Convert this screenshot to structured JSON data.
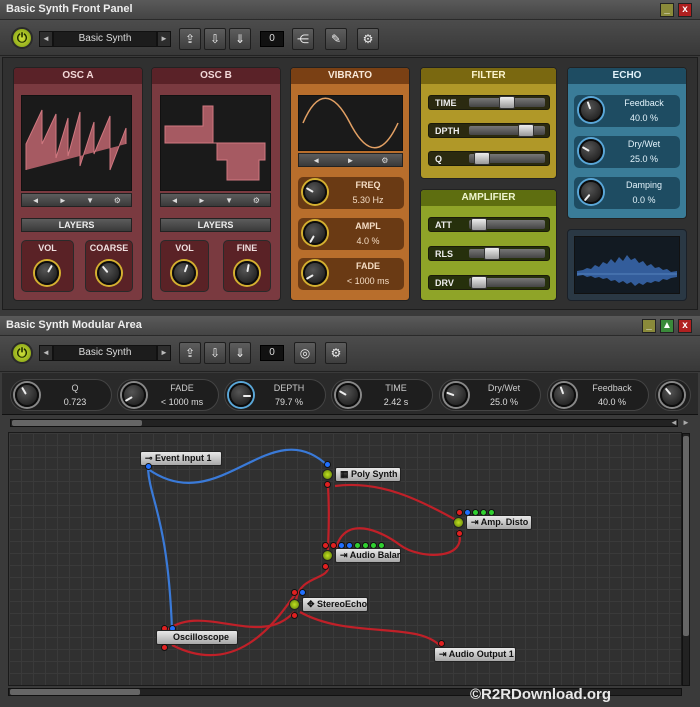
{
  "front_panel": {
    "title": "Basic Synth Front Panel",
    "window_buttons": [
      "_",
      "x"
    ],
    "preset_name": "Basic Synth",
    "counter": "0",
    "toolbar_icons": [
      "folder-up-icon",
      "folder-down-icon",
      "folder-save-icon",
      "wiring-icon",
      "pencil-icon",
      "gear-icon"
    ]
  },
  "osc_a": {
    "title": "OSC A",
    "nav": [
      "◄",
      "►",
      "▼",
      "⚙"
    ],
    "layers": "LAYERS",
    "knob1": "VOL",
    "knob2": "COARSE"
  },
  "osc_b": {
    "title": "OSC B",
    "nav": [
      "◄",
      "►",
      "▼",
      "⚙"
    ],
    "layers": "LAYERS",
    "knob1": "VOL",
    "knob2": "FINE"
  },
  "vibrato": {
    "title": "VIBRATO",
    "nav": [
      "◄",
      "►",
      "⚙"
    ],
    "params": [
      {
        "label": "FREQ",
        "value": "5.30 Hz"
      },
      {
        "label": "AMPL",
        "value": "4.0 %"
      },
      {
        "label": "FADE",
        "value": "< 1000 ms"
      }
    ]
  },
  "filter": {
    "title": "FILTER",
    "sliders": [
      {
        "label": "TIME",
        "level": 0.5
      },
      {
        "label": "DPTH",
        "level": 0.75
      },
      {
        "label": "Q",
        "level": 0.12
      }
    ]
  },
  "amplifier": {
    "title": "AMPLIFIER",
    "sliders": [
      {
        "label": "ATT",
        "level": 0.05
      },
      {
        "label": "RLS",
        "level": 0.2
      },
      {
        "label": "DRV",
        "level": 0.05
      }
    ]
  },
  "echo": {
    "title": "ECHO",
    "params": [
      {
        "label": "Feedback",
        "value": "40.0 %"
      },
      {
        "label": "Dry/Wet",
        "value": "25.0 %"
      },
      {
        "label": "Damping",
        "value": "0.0 %"
      }
    ]
  },
  "modular": {
    "title": "Basic Synth Modular Area",
    "window_buttons": [
      "_",
      "▲",
      "x"
    ],
    "preset_name": "Basic Synth",
    "counter": "0",
    "controls": [
      {
        "label": "Q",
        "value": "0.723"
      },
      {
        "label": "FADE",
        "value": "< 1000 ms"
      },
      {
        "label": "DEPTH",
        "value": "79.7 %"
      },
      {
        "label": "TIME",
        "value": "2.42 s"
      },
      {
        "label": "Dry/Wet",
        "value": "25.0 %"
      },
      {
        "label": "Feedback",
        "value": "40.0 %"
      }
    ],
    "nodes": {
      "event_input": "Event Input 1",
      "poly_synth": "Poly Synth",
      "amp_disto": "Amp. Disto",
      "audio_balance": "Audio Balar",
      "stereo_echo": "StereoEcho",
      "oscilloscope": "Oscilloscope",
      "audio_output": "Audio Output 1"
    }
  },
  "watermark": "©R2RDownload.org",
  "colors": {
    "osc": "#8a3c44",
    "vibrato": "#c0742c",
    "filter": "#b8a030",
    "amplifier": "#94aa2c",
    "echo": "#3a7e9c",
    "accent_green": "#a8c820"
  }
}
